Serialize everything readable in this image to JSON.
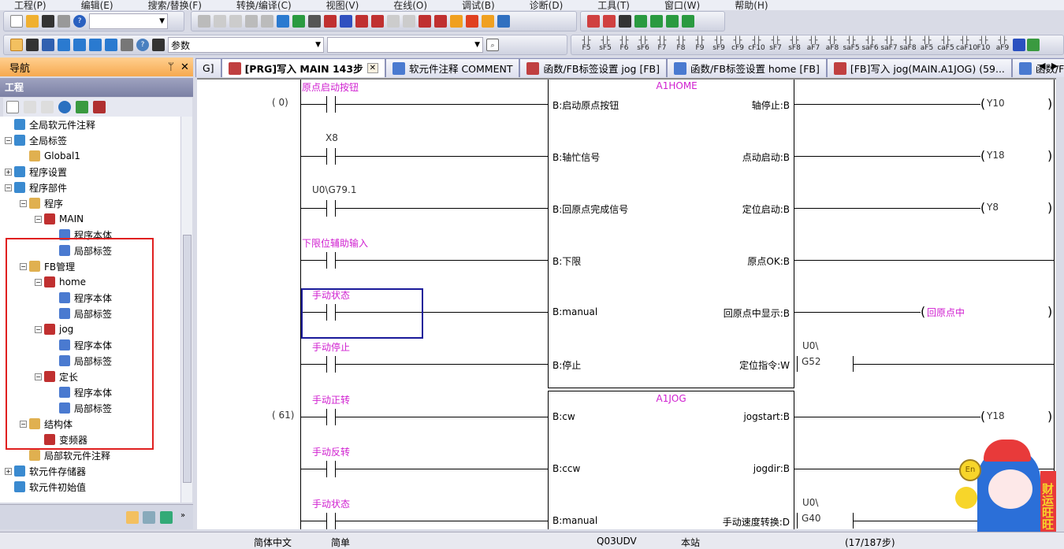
{
  "menu": [
    "工程(P)",
    "编辑(E)",
    "搜索/替换(F)",
    "转换/编译(C)",
    "视图(V)",
    "在线(O)",
    "调试(B)",
    "诊断(D)",
    "工具(T)",
    "窗口(W)",
    "帮助(H)"
  ],
  "toolbar2": {
    "search_value": "参数",
    "second_value": ""
  },
  "ladder_keys": [
    "F5",
    "sF5",
    "F6",
    "sF6",
    "F7",
    "F8",
    "F9",
    "sF9",
    "cF9",
    "cF10",
    "sF7",
    "sF8",
    "aF7",
    "aF8",
    "saF5",
    "saF6",
    "saF7",
    "saF8",
    "aF5",
    "caF5",
    "caF10",
    "F10",
    "aF9"
  ],
  "nav": {
    "title": "导航",
    "pin": "ᛘ",
    "close": "✕",
    "project_header": "工程"
  },
  "tree": [
    {
      "label": "全局软元件注释",
      "level": 0,
      "exp": ""
    },
    {
      "label": "全局标签",
      "level": 0,
      "exp": "−"
    },
    {
      "label": "Global1",
      "level": 1,
      "exp": ""
    },
    {
      "label": "程序设置",
      "level": 0,
      "exp": "+"
    },
    {
      "label": "程序部件",
      "level": 0,
      "exp": "−"
    },
    {
      "label": "程序",
      "level": 1,
      "exp": "−"
    },
    {
      "label": "MAIN",
      "level": 2,
      "exp": "−"
    },
    {
      "label": "程序本体",
      "level": 3,
      "exp": ""
    },
    {
      "label": "局部标签",
      "level": 3,
      "exp": ""
    },
    {
      "label": "FB管理",
      "level": 1,
      "exp": "−"
    },
    {
      "label": "home",
      "level": 2,
      "exp": "−"
    },
    {
      "label": "程序本体",
      "level": 3,
      "exp": ""
    },
    {
      "label": "局部标签",
      "level": 3,
      "exp": ""
    },
    {
      "label": "jog",
      "level": 2,
      "exp": "−"
    },
    {
      "label": "程序本体",
      "level": 3,
      "exp": ""
    },
    {
      "label": "局部标签",
      "level": 3,
      "exp": ""
    },
    {
      "label": "定长",
      "level": 2,
      "exp": "−"
    },
    {
      "label": "程序本体",
      "level": 3,
      "exp": ""
    },
    {
      "label": "局部标签",
      "level": 3,
      "exp": ""
    },
    {
      "label": "结构体",
      "level": 1,
      "exp": "−"
    },
    {
      "label": "变频器",
      "level": 2,
      "exp": ""
    },
    {
      "label": "局部软元件注释",
      "level": 1,
      "exp": ""
    },
    {
      "label": "软元件存储器",
      "level": 0,
      "exp": "+"
    },
    {
      "label": "软元件初始值",
      "level": 0,
      "exp": ""
    }
  ],
  "tabs": [
    {
      "label": "G]",
      "active": false
    },
    {
      "label": "[PRG]写入 MAIN 143步",
      "active": true
    },
    {
      "label": "软元件注释 COMMENT",
      "active": false
    },
    {
      "label": "函数/FB标签设置 jog [FB]",
      "active": false
    },
    {
      "label": "函数/FB标签设置 home [FB]",
      "active": false
    },
    {
      "label": "[FB]写入 jog(MAIN.A1JOG) (59...",
      "active": false
    },
    {
      "label": "函数/FB标签",
      "active": false
    }
  ],
  "ladder": {
    "blocks": [
      {
        "step": "(     0)",
        "name": "A1HOME",
        "rows": [
          {
            "contact": "",
            "comment": "原点启动按钮",
            "in": "B:启动原点按钮",
            "out": "轴停止:B",
            "coil": "Y10",
            "coil_comment": false,
            "dev_top": ""
          },
          {
            "contact": "X8",
            "comment": "",
            "in": "B:轴忙信号",
            "out": "点动启动:B",
            "coil": "Y18",
            "coil_comment": false,
            "dev_top": ""
          },
          {
            "contact": "U0\\G79.1",
            "comment": "",
            "in": "B:回原点完成信号",
            "out": "定位启动:B",
            "coil": "Y8",
            "coil_comment": false,
            "dev_top": ""
          },
          {
            "contact": "",
            "comment": "下限位辅助输入",
            "in": "B:下限",
            "out": "原点OK:B",
            "coil": "",
            "coil_comment": false,
            "dev_top": ""
          },
          {
            "contact": "",
            "comment": "手动状态",
            "in": "B:manual",
            "out": "回原点中显示:B",
            "coil": "回原点中",
            "coil_comment": true,
            "dev_top": ""
          },
          {
            "contact": "",
            "comment": "手动停止",
            "in": "B:停止",
            "out": "定位指令:W",
            "word": "G52",
            "dev_top": "U0\\"
          }
        ]
      },
      {
        "step": "(    61)",
        "name": "A1JOG",
        "rows": [
          {
            "contact": "",
            "comment": "手动正转",
            "in": "B:cw",
            "out": "jogstart:B",
            "coil": "Y18",
            "coil_comment": false,
            "dev_top": ""
          },
          {
            "contact": "",
            "comment": "手动反转",
            "in": "B:ccw",
            "out": "jogdir:B",
            "coil": "",
            "coil_comment": false,
            "dev_top": ""
          },
          {
            "contact": "",
            "comment": "手动状态",
            "in": "B:manual",
            "out": "手动速度转换:D",
            "word": "G40",
            "dev_top": "U0\\"
          }
        ]
      }
    ]
  },
  "status": {
    "language": "简体中文",
    "mode": "简单",
    "cpu": "Q03UDV",
    "station": "本站",
    "steps": "(17/187步)"
  },
  "mascot": {
    "badge": "En",
    "banner": "财运旺旺"
  },
  "colors": {
    "comment": "#d020d0",
    "selection": "#1a1a9a",
    "red_highlight": "#e02020",
    "nav_header": "#f6a94f"
  }
}
